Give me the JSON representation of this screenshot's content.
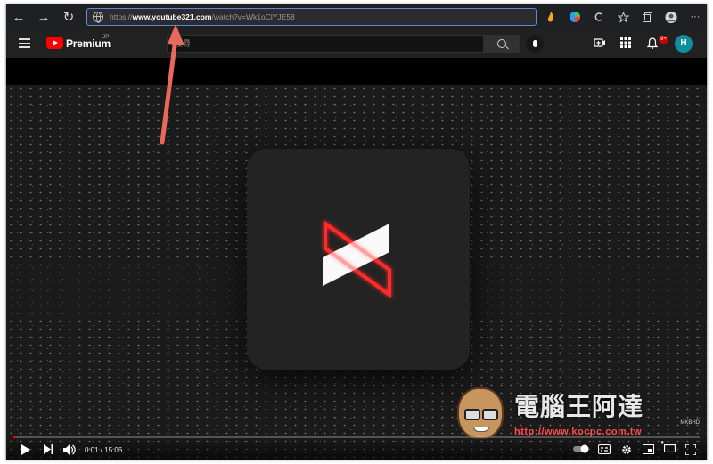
{
  "browser": {
    "url_prefix": "https://",
    "url_domain": "www.youtube321.com",
    "url_path": "/watch?v=Wk1oClYJE58",
    "nav": {
      "back": "←",
      "forward": "→",
      "reload": "↻"
    },
    "menu_label": "···"
  },
  "youtube": {
    "logo_text": "Premium",
    "logo_region": "JP",
    "search_placeholder": "搜尋",
    "notification_count": "9+",
    "avatar_initial": "H"
  },
  "player": {
    "time_display": "0:01 / 15:06",
    "channel_watermark": "MKBHD",
    "progress_fraction": 0.001
  },
  "overlay_watermark": {
    "title": "電腦王阿達",
    "url": "http://www.kocpc.com.tw"
  },
  "colors": {
    "accent": "#ff0000",
    "annotation_arrow": "#e8685a",
    "avatar": "#0f8e9e"
  }
}
